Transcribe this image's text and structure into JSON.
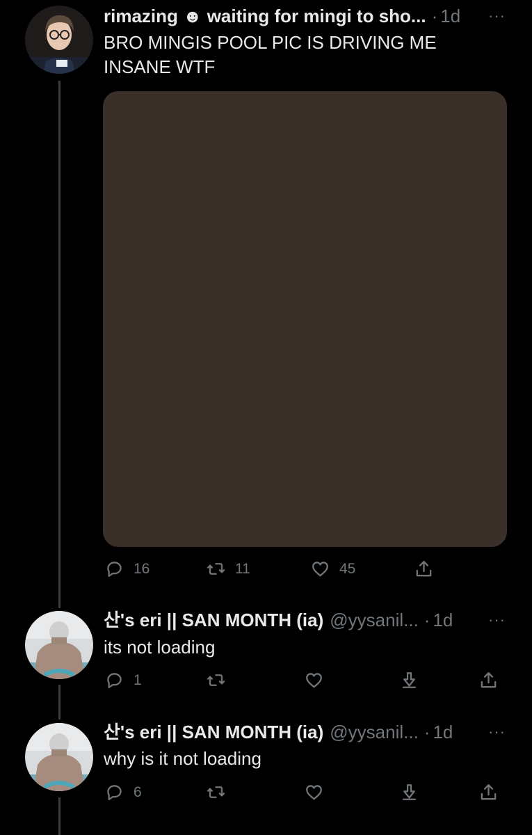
{
  "tweets": [
    {
      "name": "rimazing ☻ waiting for mingi to sho...",
      "handle": "",
      "separator": "·",
      "time": "1d",
      "more": "···",
      "text": "BRO MINGIS POOL PIC IS DRIVING ME INSANE WTF",
      "media_color": "#3a2f29",
      "actions": {
        "reply": "16",
        "retweet": "11",
        "like": "45"
      }
    },
    {
      "name": "산's eri || SAN MONTH (ia)",
      "handle": "@yysanil...",
      "separator": "·",
      "time": "1d",
      "more": "···",
      "text": "its not loading",
      "actions": {
        "reply": "1",
        "retweet": "",
        "like": ""
      }
    },
    {
      "name": "산's eri || SAN MONTH (ia)",
      "handle": "@yysanil...",
      "separator": "·",
      "time": "1d",
      "more": "···",
      "text": "why is it not loading",
      "actions": {
        "reply": "6",
        "retweet": "",
        "like": ""
      }
    }
  ],
  "icons": {
    "reply": "speech-bubble-icon",
    "retweet": "retweet-arrows-icon",
    "like": "heart-icon",
    "download": "download-arrow-icon",
    "share": "share-upload-icon"
  },
  "colors": {
    "background": "#000000",
    "text": "#e7e9ea",
    "secondary": "#71767b",
    "thread_line": "#3a3d41"
  }
}
